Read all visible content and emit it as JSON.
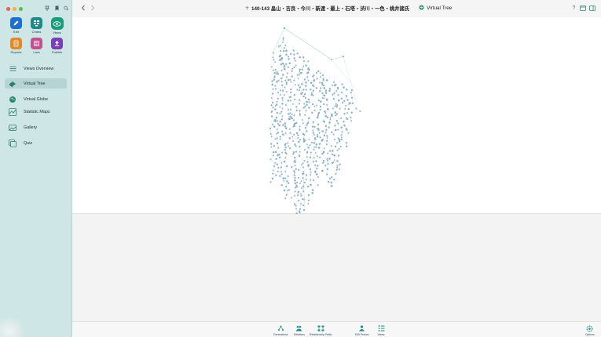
{
  "window": {
    "document_title": "140-143 畠山・吉良・今川・新渡・最上・石塔・渋川・一色・桃井諸氏",
    "view_name": "Virtual Tree"
  },
  "modes": [
    {
      "label": "Edit",
      "icon": "pencil-icon",
      "color": "#1f6fd1"
    },
    {
      "label": "Charts",
      "icon": "charts-icon",
      "color": "#1f8a8a"
    },
    {
      "label": "Views",
      "icon": "eye-icon",
      "color": "#1a9c7a",
      "selected": true
    },
    {
      "label": "Reports",
      "icon": "reports-icon",
      "color": "#e08a2c"
    },
    {
      "label": "Lists",
      "icon": "lists-icon",
      "color": "#c2508e"
    },
    {
      "label": "Publish",
      "icon": "publish-icon",
      "color": "#7a3fb8"
    }
  ],
  "sidebar": {
    "items": [
      {
        "label": "Views Overview",
        "icon": "list-icon"
      },
      {
        "label": "Virtual Tree",
        "icon": "virtual-tree-icon",
        "selected": true
      },
      {
        "label": "Virtual Globe",
        "icon": "globe-icon"
      },
      {
        "label": "Statistic Maps",
        "icon": "statistic-maps-icon"
      },
      {
        "label": "Gallery",
        "icon": "gallery-icon"
      },
      {
        "label": "Quiz",
        "icon": "quiz-icon"
      }
    ]
  },
  "bottom_bar": {
    "buttons": [
      {
        "label": "Generations",
        "icon": "generations-icon"
      },
      {
        "label": "Relatives",
        "icon": "relatives-icon"
      },
      {
        "label": "Relationship Paths",
        "icon": "relationship-paths-icon"
      },
      {
        "label": "Edit Person",
        "icon": "edit-person-icon"
      },
      {
        "label": "Views",
        "icon": "views-icon"
      }
    ],
    "options_label": "Options"
  },
  "colors": {
    "sidebar_bg": "#cfe6e6",
    "sidebar_selected": "#b6d4d4",
    "accent": "#1a9c7a",
    "tree_node": "#8fb0c4",
    "tree_edge": "#9cc7c2"
  }
}
